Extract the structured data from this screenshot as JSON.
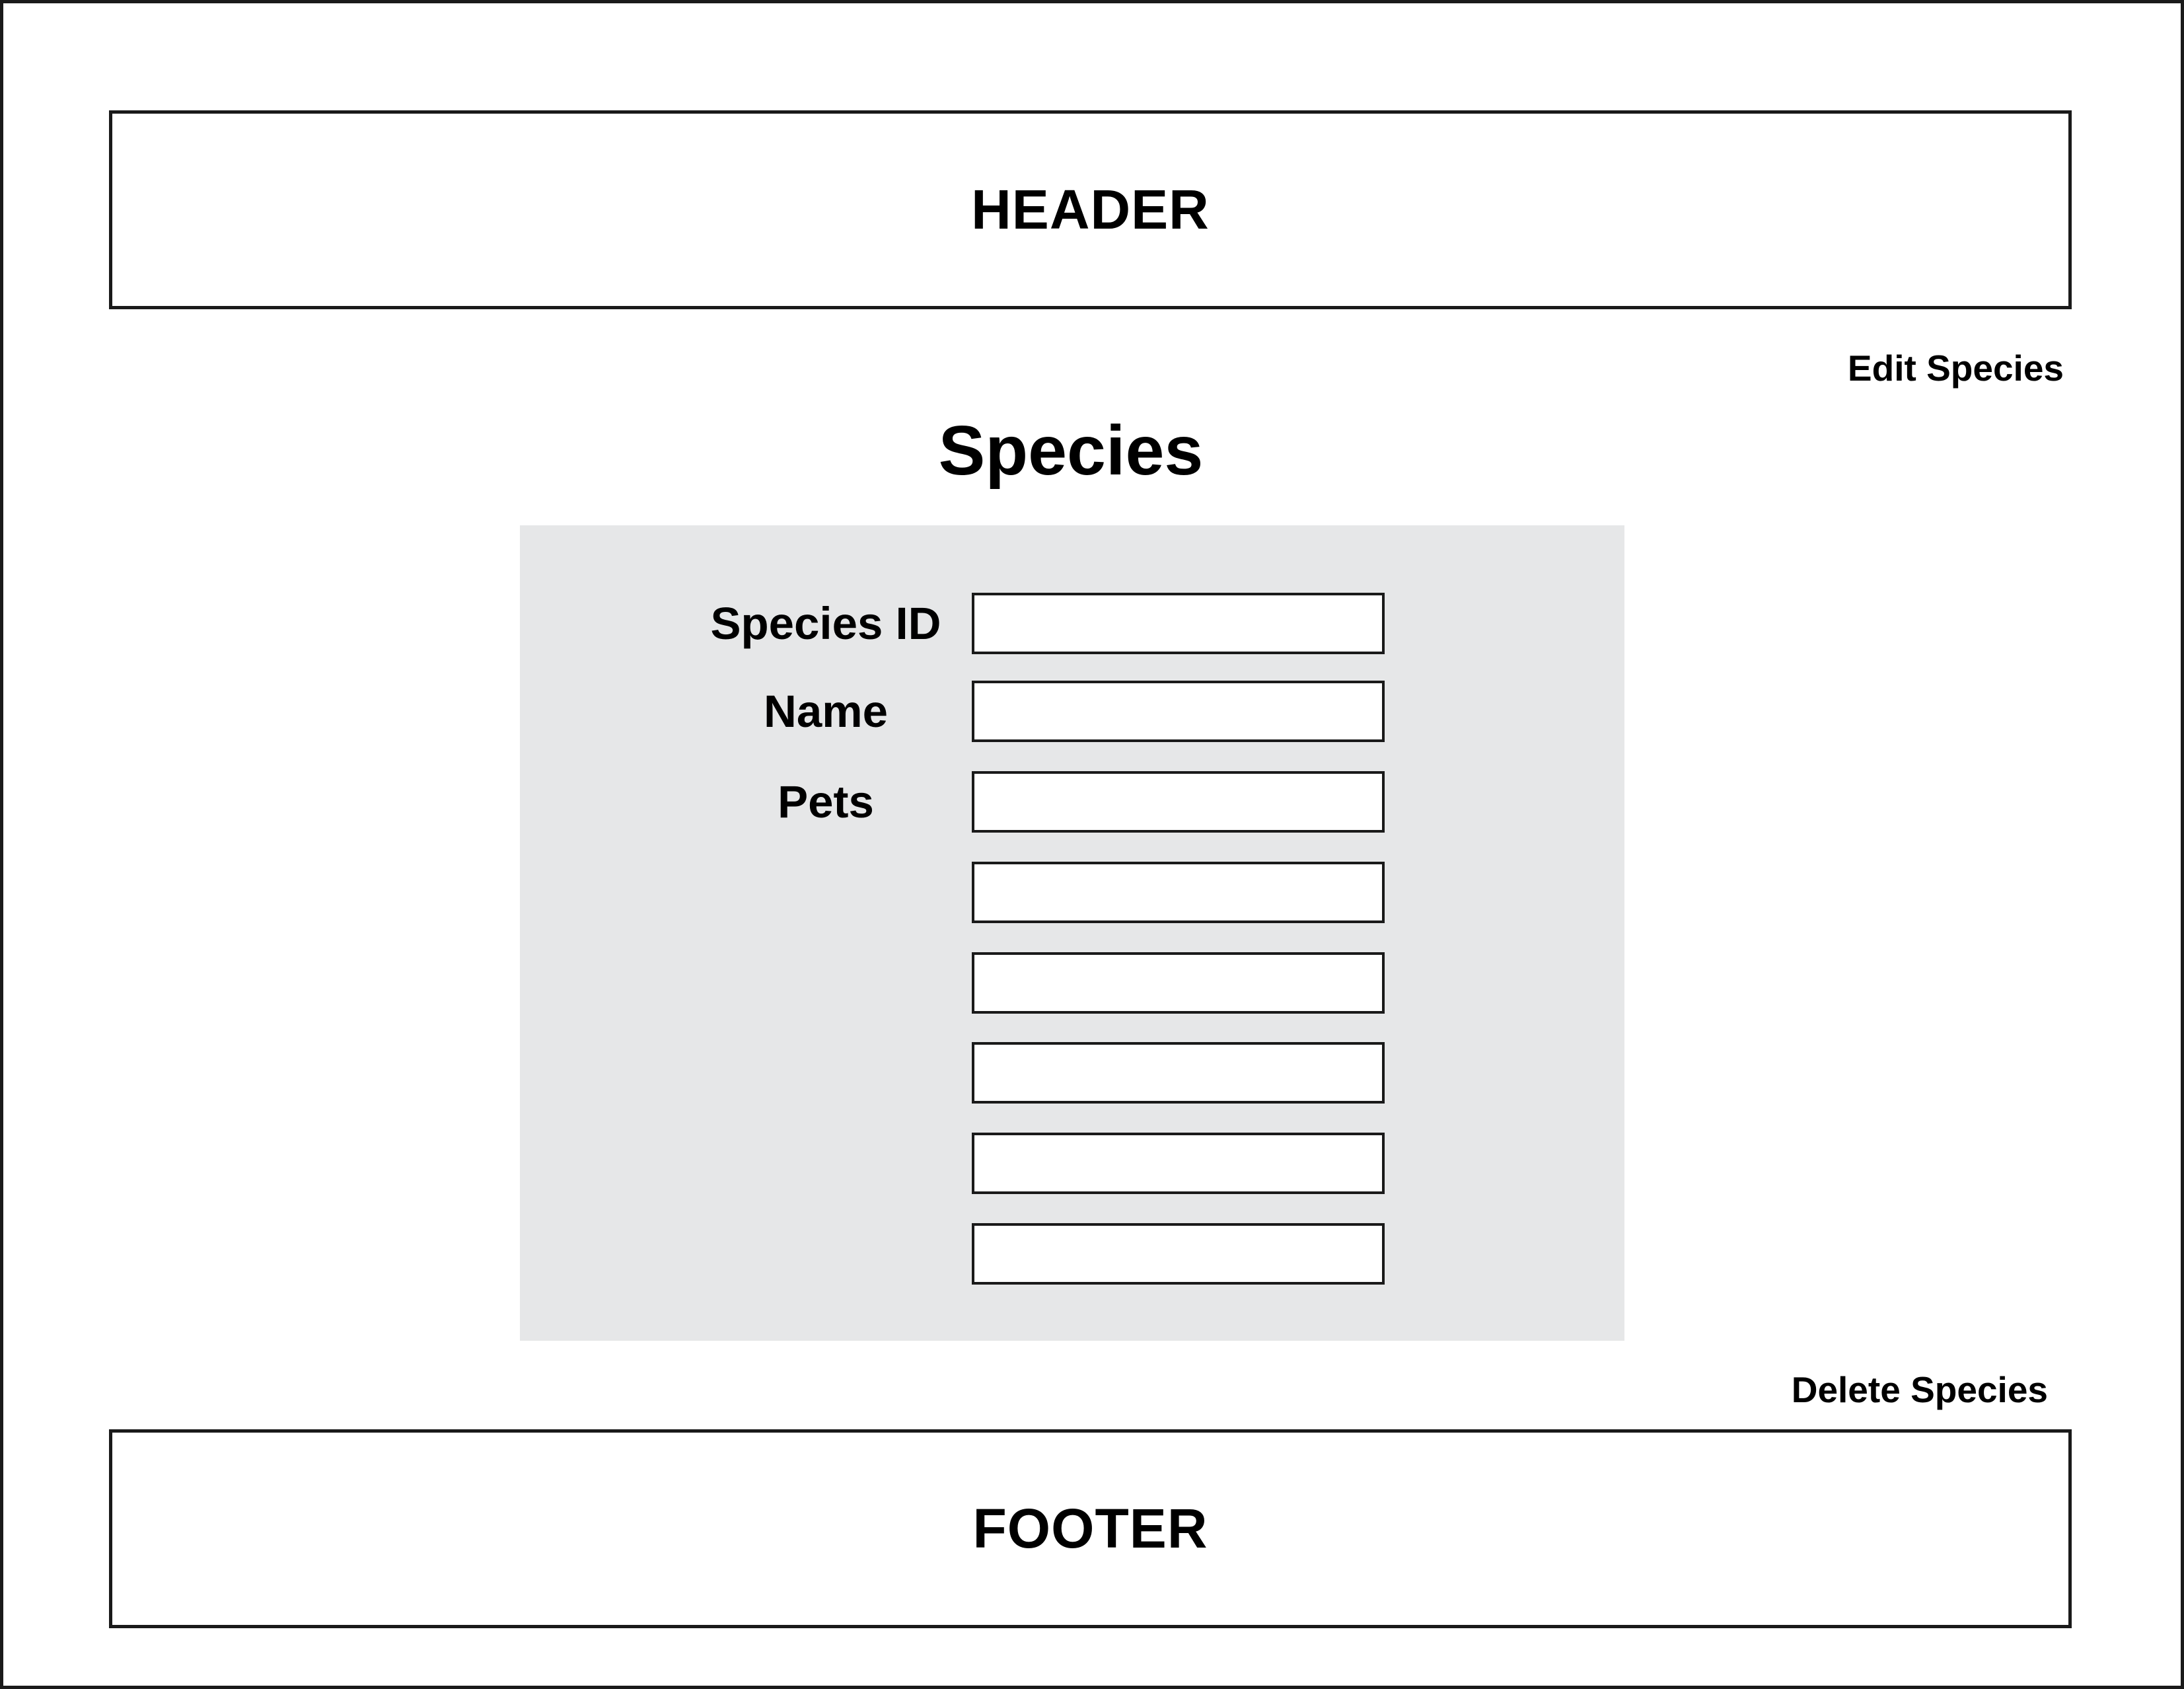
{
  "header": {
    "title": "HEADER"
  },
  "actions": {
    "edit_label": "Edit Species",
    "delete_label": "Delete Species"
  },
  "page": {
    "title": "Species"
  },
  "form": {
    "fields": [
      {
        "label": "Species ID",
        "value": ""
      },
      {
        "label": "Name",
        "value": ""
      },
      {
        "label": "Pets",
        "value": ""
      }
    ],
    "pet_extra_inputs": [
      "",
      "",
      "",
      "",
      ""
    ]
  },
  "footer": {
    "title": "FOOTER"
  },
  "colors": {
    "panel_background": "#e6e7e8",
    "border": "#1a1a1a",
    "page_background": "#ffffff"
  }
}
